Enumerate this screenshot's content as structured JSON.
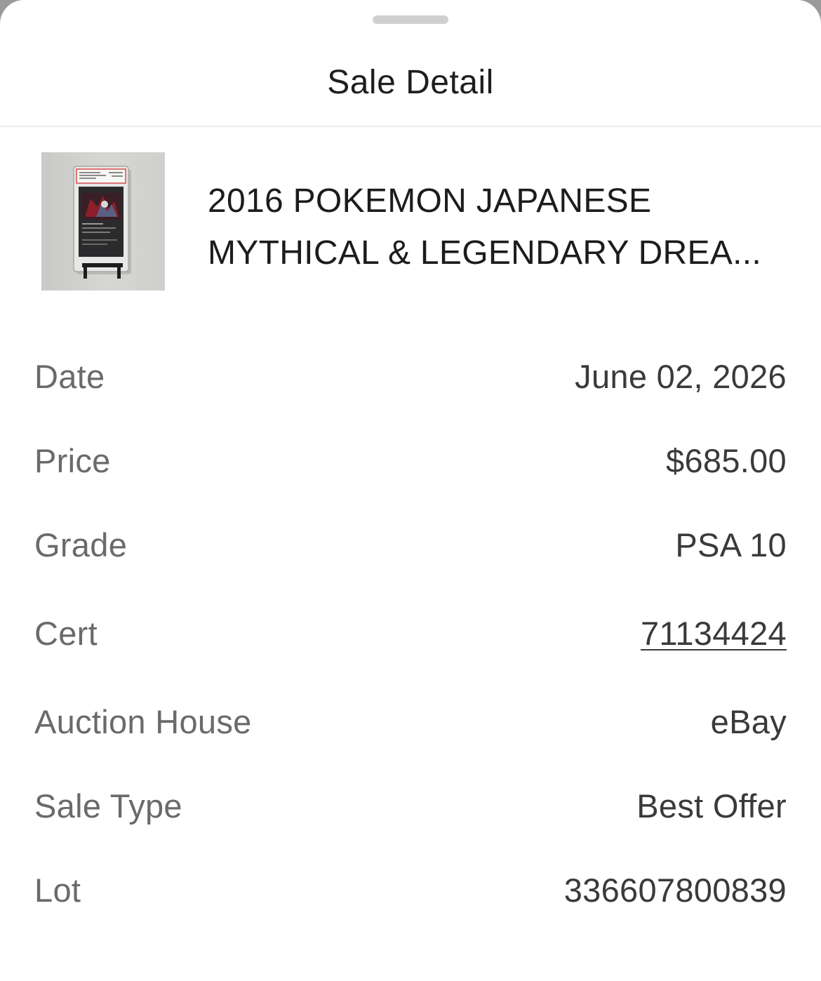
{
  "sheet": {
    "title": "Sale Detail"
  },
  "product": {
    "thumbnail_icon": "graded-card-slab-image",
    "title_line1": "2016 POKEMON JAPANESE",
    "title_line2": "MYTHICAL & LEGENDARY DREA..."
  },
  "details": {
    "date_label": "Date",
    "date_value": "June 02, 2026",
    "price_label": "Price",
    "price_value": "$685.00",
    "grade_label": "Grade",
    "grade_value": "PSA 10",
    "cert_label": "Cert",
    "cert_value": "71134424",
    "auction_house_label": "Auction House",
    "auction_house_value": "eBay",
    "sale_type_label": "Sale Type",
    "sale_type_value": "Best Offer",
    "lot_label": "Lot",
    "lot_value": "336607800839"
  },
  "colors": {
    "text_primary": "#1e1e1e",
    "text_label": "#6a6a6a",
    "text_value": "#3a3a3a",
    "divider": "#ececec"
  }
}
